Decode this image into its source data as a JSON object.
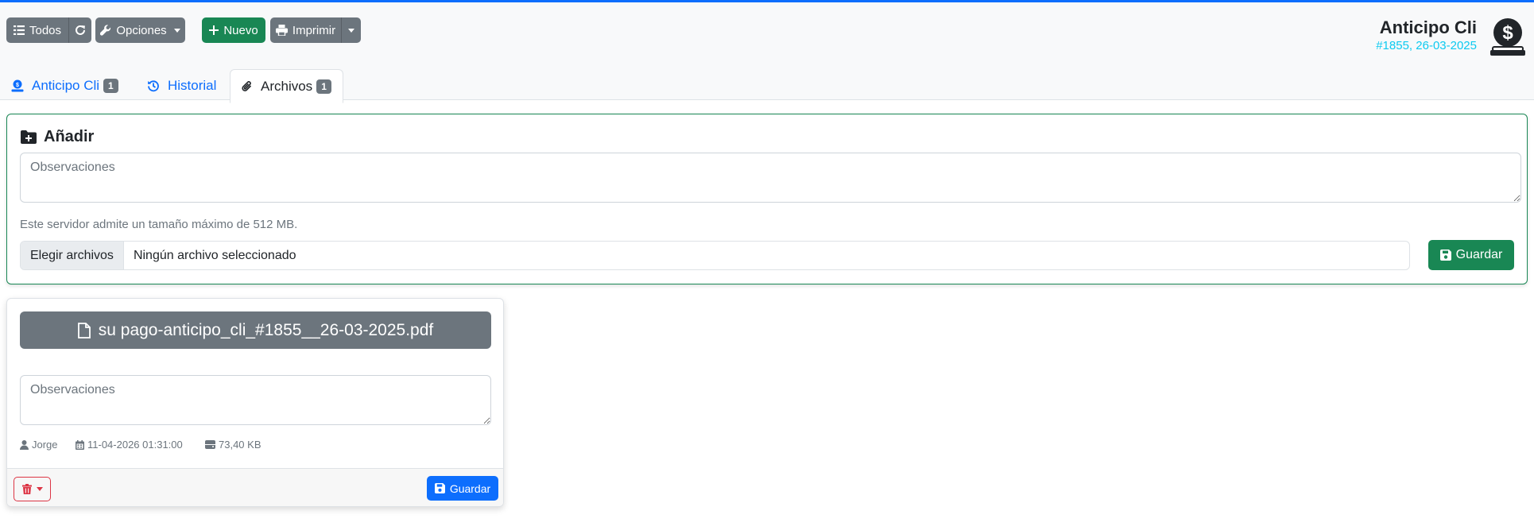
{
  "toolbar": {
    "todos_label": "Todos",
    "opciones_label": "Opciones",
    "nuevo_label": "Nuevo",
    "imprimir_label": "Imprimir"
  },
  "header": {
    "title": "Anticipo Cli",
    "subtitle": "#1855, 26-03-2025"
  },
  "tabs": [
    {
      "label": "Anticipo Cli",
      "badge": "1",
      "active": false
    },
    {
      "label": "Historial",
      "badge": "",
      "active": false
    },
    {
      "label": "Archivos",
      "badge": "1",
      "active": true
    }
  ],
  "add_panel": {
    "title": "Añadir",
    "observations_placeholder": "Observaciones",
    "help_text": "Este servidor admite un tamaño máximo de 512 MB.",
    "choose_files_label": "Elegir archivos",
    "no_file_label": "Ningún archivo seleccionado",
    "save_label": "Guardar"
  },
  "file_card": {
    "file_name": "su pago-anticipo_cli_#1855__26-03-2025.pdf",
    "observations_placeholder": "Observaciones",
    "user": "Jorge",
    "date": "11-04-2026 01:31:00",
    "size": "73,40 KB",
    "save_label": "Guardar"
  },
  "colors": {
    "primary": "#0d6efd",
    "success": "#198754",
    "secondary": "#6c757d",
    "danger": "#dc3545",
    "info": "#0dcaf0"
  }
}
